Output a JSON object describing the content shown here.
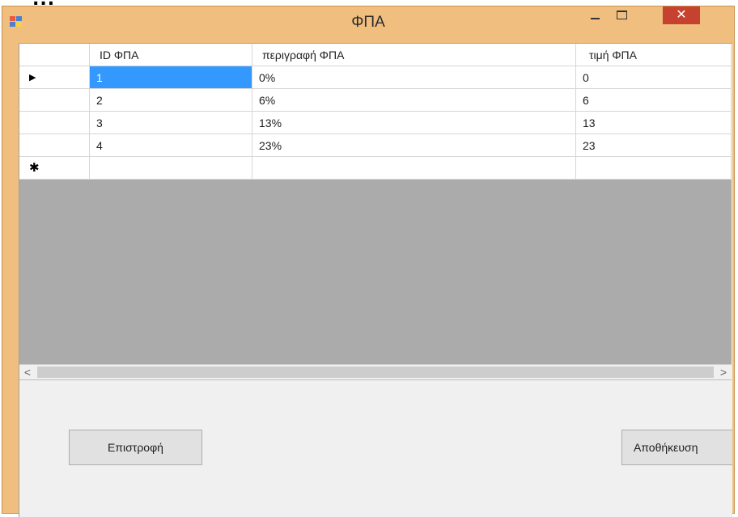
{
  "top_text": "...",
  "window": {
    "title": "ΦΠΑ",
    "minimize": "",
    "maximize": "",
    "close": "✕"
  },
  "grid": {
    "row_marker": "▶",
    "new_row_marker": "✱",
    "columns": [
      "ID ΦΠΑ",
      "περιγραφή ΦΠΑ",
      "τιμή ΦΠΑ"
    ],
    "rows": [
      [
        "1",
        "0%",
        "0"
      ],
      [
        "2",
        "6%",
        "6"
      ],
      [
        "3",
        "13%",
        "13"
      ],
      [
        "4",
        "23%",
        "23"
      ]
    ],
    "scroll_left": "<",
    "scroll_right": ">"
  },
  "buttons": {
    "back_label": "Επιστροφή",
    "save_label": "Αποθήκευση"
  }
}
